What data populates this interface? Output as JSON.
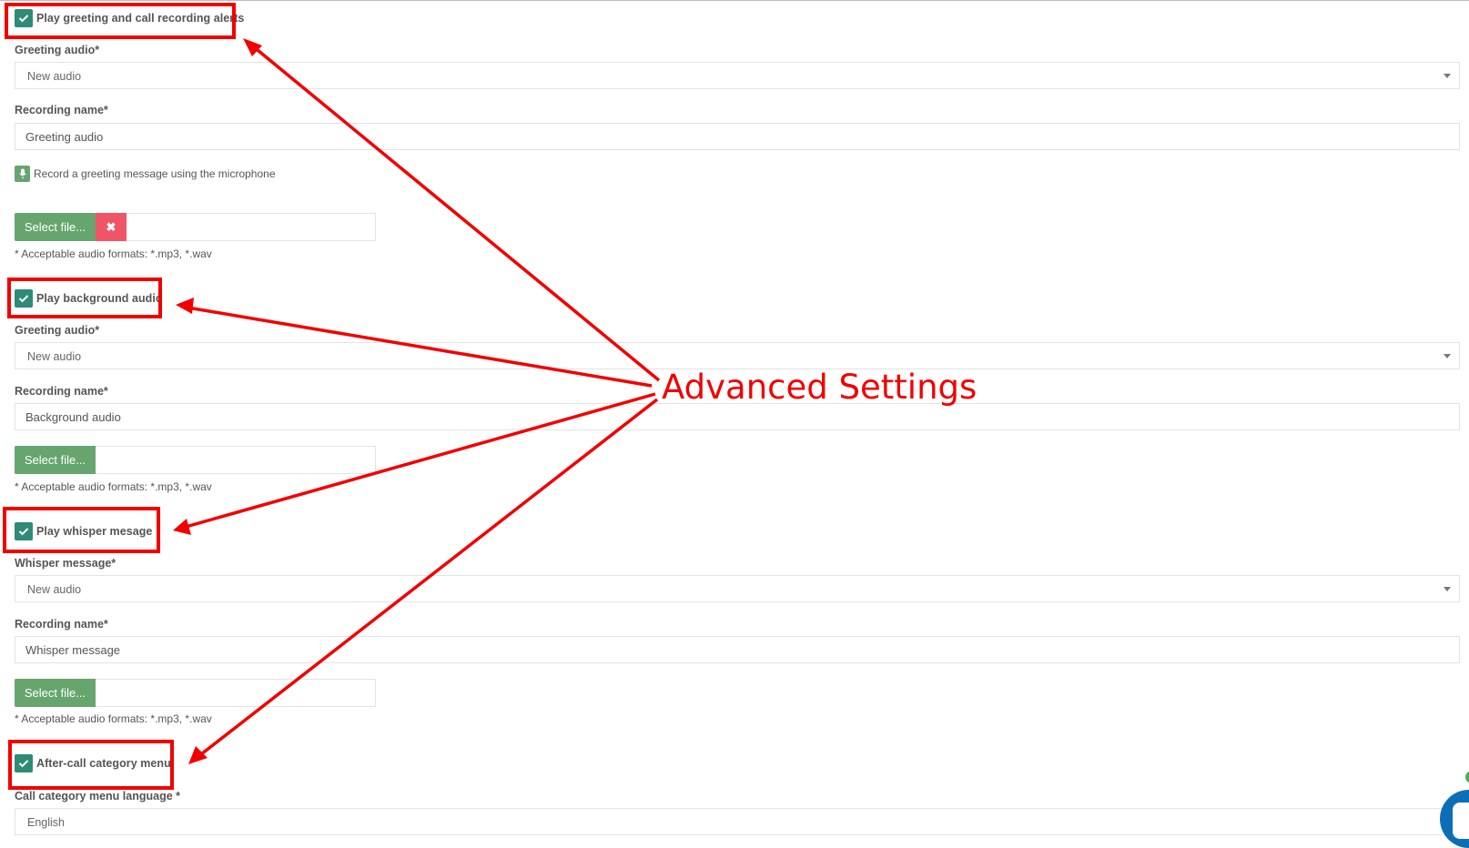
{
  "annotation": {
    "label": "Advanced Settings",
    "color": "#f20000"
  },
  "sections": [
    {
      "checkbox_label": "Play greeting and call recording alerts",
      "checked": true,
      "select_label": "Greeting audio*",
      "select_value": "New audio",
      "name_label": "Recording name*",
      "name_value": "Greeting audio",
      "record_text": "Record a greeting message using the microphone",
      "select_file_label": "Select file...",
      "remove_label": "✖",
      "formats_text": "* Acceptable audio formats: *.mp3, *.wav"
    },
    {
      "checkbox_label": "Play background audio",
      "checked": true,
      "select_label": "Greeting audio*",
      "select_value": "New audio",
      "name_label": "Recording name*",
      "name_value": "Background audio",
      "select_file_label": "Select file...",
      "formats_text": "* Acceptable audio formats: *.mp3, *.wav"
    },
    {
      "checkbox_label": "Play whisper mesage",
      "checked": true,
      "select_label": "Whisper message*",
      "select_value": "New audio",
      "name_label": "Recording name*",
      "name_value": "Whisper message",
      "select_file_label": "Select file...",
      "formats_text": "* Acceptable audio formats: *.mp3, *.wav"
    },
    {
      "checkbox_label": "After-call category menu",
      "checked": true,
      "select_label": "Call category menu language *",
      "select_value": "English"
    }
  ],
  "colors": {
    "checkbox": "#2e8b76",
    "select_file_button": "#67a56f",
    "remove_button": "#ef5567",
    "annotation_red": "#f20000",
    "chat_widget": "#0b6fb8"
  }
}
